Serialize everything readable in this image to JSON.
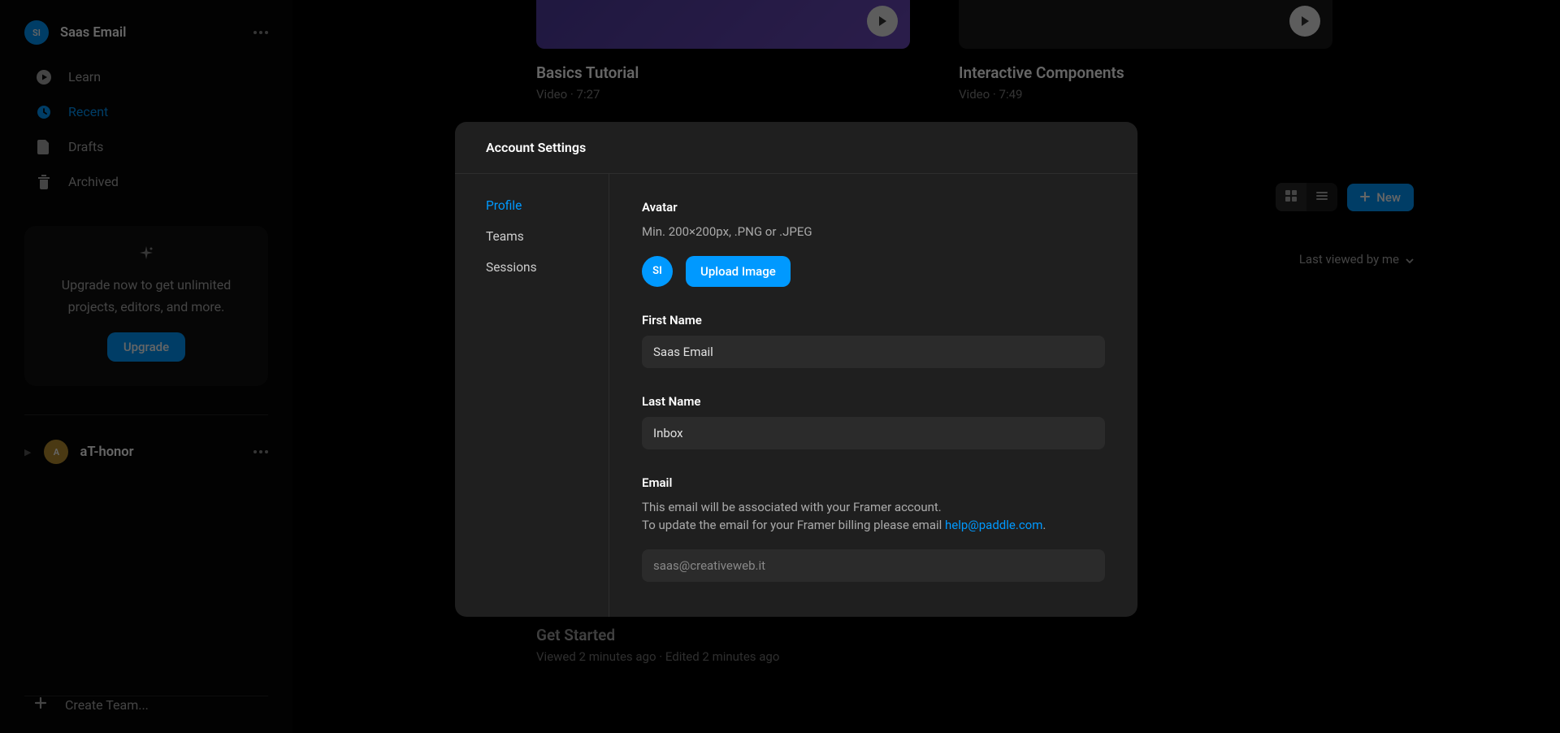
{
  "sidebar": {
    "workspace_avatar_text": "SI",
    "workspace_name": "Saas Email",
    "nav": [
      {
        "label": "Learn",
        "icon": "play-circle-icon"
      },
      {
        "label": "Recent",
        "icon": "clock-icon"
      },
      {
        "label": "Drafts",
        "icon": "file-icon"
      },
      {
        "label": "Archived",
        "icon": "trash-icon"
      }
    ],
    "upgrade_text": "Upgrade now to get unlimited projects, editors, and more.",
    "upgrade_button": "Upgrade",
    "team_avatar_text": "A",
    "team_name": "aT-honor",
    "create_team_label": "Create Team..."
  },
  "tutorials": [
    {
      "title": "Basics Tutorial",
      "meta": "Video · 7:27"
    },
    {
      "title": "Interactive Components",
      "meta": "Video · 7:49"
    }
  ],
  "toolbar": {
    "new_label": "New",
    "sort_label": "Last viewed by me"
  },
  "project": {
    "title": "Get Started",
    "meta": "Viewed 2 minutes ago · Edited 2 minutes ago"
  },
  "modal": {
    "title": "Account Settings",
    "nav": [
      "Profile",
      "Teams",
      "Sessions"
    ],
    "avatar_label": "Avatar",
    "avatar_sub": "Min. 200×200px, .PNG or .JPEG",
    "avatar_text": "SI",
    "upload_label": "Upload Image",
    "firstname_label": "First Name",
    "firstname_value": "Saas Email",
    "lastname_label": "Last Name",
    "lastname_value": "Inbox",
    "email_label": "Email",
    "email_sub_1": "This email will be associated with your Framer account.",
    "email_sub_2a": "To update the email for your Framer billing please email ",
    "email_sub_link": "help@paddle.com",
    "email_sub_2b": ".",
    "email_value": "saas@creativeweb.it"
  }
}
